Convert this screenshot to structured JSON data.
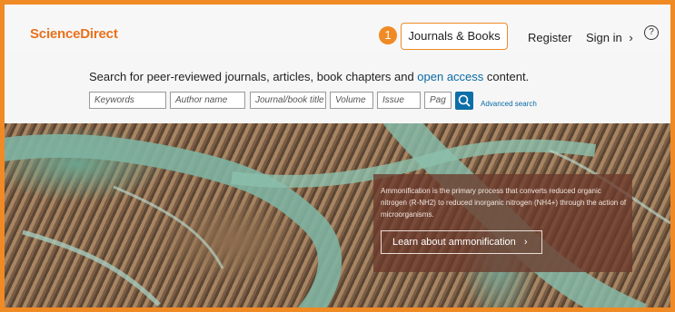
{
  "header": {
    "logo": "ScienceDirect",
    "callout_number": "1",
    "journals_label": "Journals & Books",
    "register_label": "Register",
    "signin_label": "Sign in",
    "signin_chevron": "›",
    "help_glyph": "?"
  },
  "search": {
    "title_prefix": "Search for peer-reviewed journals, articles, book chapters and ",
    "title_link": "open access",
    "title_suffix": " content.",
    "fields": [
      {
        "placeholder": "Keywords"
      },
      {
        "placeholder": "Author name"
      },
      {
        "placeholder": "Journal/book title"
      },
      {
        "placeholder": "Volume"
      },
      {
        "placeholder": "Issue"
      },
      {
        "placeholder": "Pag"
      }
    ],
    "advanced_label": "Advanced search"
  },
  "hero": {
    "text": "Ammonification is the primary process that converts reduced organic nitrogen (R-NH2) to reduced inorganic nitrogen (NH4+) through the action of microorganisms.",
    "button_label": "Learn about ammonification",
    "button_chevron": "›"
  },
  "icons": {
    "search": "magnifier-icon",
    "help": "help-circle-icon",
    "chevron": "chevron-right-icon"
  },
  "colors": {
    "brand": "#e9711c",
    "highlight": "#f08a24",
    "link": "#0b6aa5",
    "search_button": "#0d6ea8"
  }
}
